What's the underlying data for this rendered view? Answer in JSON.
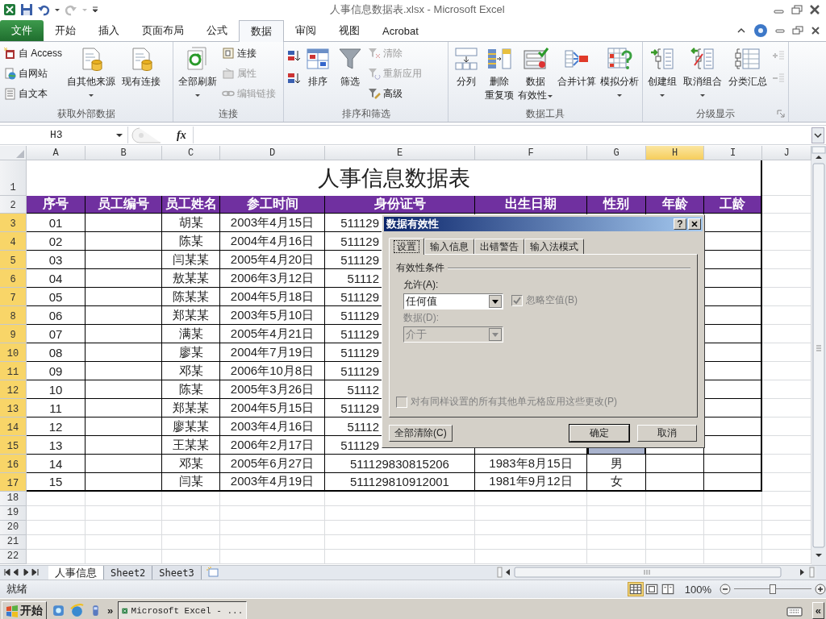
{
  "window": {
    "title": "人事信息数据表.xlsx - Microsoft Excel"
  },
  "ribbon_tabs": [
    {
      "label": "文件",
      "kind": "file",
      "selected": false
    },
    {
      "label": "开始",
      "kind": "tab",
      "selected": false
    },
    {
      "label": "插入",
      "kind": "tab",
      "selected": false
    },
    {
      "label": "页面布局",
      "kind": "tab",
      "selected": false
    },
    {
      "label": "公式",
      "kind": "tab",
      "selected": false
    },
    {
      "label": "数据",
      "kind": "tab",
      "selected": true
    },
    {
      "label": "审阅",
      "kind": "tab",
      "selected": false
    },
    {
      "label": "视图",
      "kind": "tab",
      "selected": false
    },
    {
      "label": "Acrobat",
      "kind": "tab",
      "selected": false
    }
  ],
  "ribbon_groups": [
    {
      "label": "获取外部数据",
      "columns": [
        {
          "kind": "stack",
          "items": [
            {
              "label": "自 Access",
              "disabled": false
            },
            {
              "label": "自网站",
              "disabled": false
            },
            {
              "label": "自文本",
              "disabled": false
            }
          ]
        },
        {
          "kind": "large",
          "lines": [
            "自其他来源"
          ],
          "dropdown": true,
          "disabled": false
        },
        {
          "kind": "large",
          "lines": [
            "现有连接"
          ],
          "disabled": false
        }
      ]
    },
    {
      "label": "连接",
      "columns": [
        {
          "kind": "large",
          "lines": [
            "全部刷新"
          ],
          "dropdown": true,
          "disabled": false
        },
        {
          "kind": "stack",
          "items": [
            {
              "label": "连接",
              "disabled": false
            },
            {
              "label": "属性",
              "disabled": true
            },
            {
              "label": "编辑链接",
              "disabled": true
            }
          ]
        }
      ]
    },
    {
      "label": "排序和筛选",
      "columns": [
        {
          "kind": "icons",
          "items": [
            {
              "disabled": false
            },
            {
              "disabled": false
            }
          ]
        },
        {
          "kind": "large",
          "lines": [
            "排序"
          ],
          "disabled": false
        },
        {
          "kind": "large",
          "lines": [
            "筛选"
          ],
          "disabled": false
        },
        {
          "kind": "stack",
          "items": [
            {
              "label": "清除",
              "disabled": true
            },
            {
              "label": "重新应用",
              "disabled": true
            },
            {
              "label": "高级",
              "disabled": false
            }
          ]
        }
      ]
    },
    {
      "label": "数据工具",
      "columns": [
        {
          "kind": "large",
          "lines": [
            "分列"
          ],
          "disabled": false
        },
        {
          "kind": "large",
          "lines": [
            "删除",
            "重复项"
          ],
          "disabled": false
        },
        {
          "kind": "large",
          "lines": [
            "数据",
            "有效性"
          ],
          "dropdown": true,
          "disabled": false
        },
        {
          "kind": "large",
          "lines": [
            "合并计算"
          ],
          "disabled": false
        },
        {
          "kind": "large",
          "lines": [
            "模拟分析"
          ],
          "dropdown": true,
          "disabled": false
        }
      ]
    },
    {
      "label": "分级显示",
      "launcher": true,
      "columns": [
        {
          "kind": "large",
          "lines": [
            "创建组"
          ],
          "dropdown": true,
          "disabled": false
        },
        {
          "kind": "large",
          "lines": [
            "取消组合"
          ],
          "dropdown": true,
          "disabled": false
        },
        {
          "kind": "large",
          "lines": [
            "分类汇总"
          ],
          "disabled": false
        },
        {
          "kind": "icons",
          "items": [
            {
              "disabled": true
            },
            {
              "disabled": true
            }
          ]
        }
      ]
    }
  ],
  "formula_bar": {
    "name_box": "H3",
    "function_label": "fx"
  },
  "sheet": {
    "columns": [
      {
        "label": "A",
        "selected": false
      },
      {
        "label": "B",
        "selected": false
      },
      {
        "label": "C",
        "selected": false
      },
      {
        "label": "D",
        "selected": false
      },
      {
        "label": "E",
        "selected": false
      },
      {
        "label": "F",
        "selected": false
      },
      {
        "label": "G",
        "selected": false
      },
      {
        "label": "H",
        "selected": true
      },
      {
        "label": "I",
        "selected": false
      },
      {
        "label": "J",
        "selected": false
      }
    ],
    "title_row": "1",
    "title": "人事信息数据表",
    "header_row": "2",
    "headers": [
      "序号",
      "员工编号",
      "员工姓名",
      "参工时间",
      "身份证号",
      "出生日期",
      "性别",
      "年龄",
      "工龄"
    ],
    "rows": [
      {
        "number": "3",
        "selected": true,
        "seq": "01",
        "name": "胡某",
        "join": "2003年4月15日",
        "id": "511129"
      },
      {
        "number": "4",
        "selected": true,
        "seq": "02",
        "name": "陈某",
        "join": "2004年4月16日",
        "id": "511129"
      },
      {
        "number": "5",
        "selected": true,
        "seq": "03",
        "name": "闫某某",
        "join": "2005年4月20日",
        "id": "511129"
      },
      {
        "number": "6",
        "selected": true,
        "seq": "04",
        "name": "敖某某",
        "join": "2006年3月12日",
        "id": "51112"
      },
      {
        "number": "7",
        "selected": true,
        "seq": "05",
        "name": "陈某某",
        "join": "2004年5月18日",
        "id": "511129"
      },
      {
        "number": "8",
        "selected": true,
        "seq": "06",
        "name": "郑某某",
        "join": "2003年5月10日",
        "id": "511129"
      },
      {
        "number": "9",
        "selected": true,
        "seq": "07",
        "name": "满某",
        "join": "2005年4月21日",
        "id": "511129"
      },
      {
        "number": "10",
        "selected": true,
        "seq": "08",
        "name": "廖某",
        "join": "2004年7月19日",
        "id": "511129"
      },
      {
        "number": "11",
        "selected": true,
        "seq": "09",
        "name": "邓某",
        "join": "2006年10月8日",
        "id": "511129"
      },
      {
        "number": "12",
        "selected": true,
        "seq": "10",
        "name": "陈某",
        "join": "2005年3月26日",
        "id": "51112"
      },
      {
        "number": "13",
        "selected": true,
        "seq": "11",
        "name": "郑某某",
        "join": "2004年5月15日",
        "id": "511129"
      },
      {
        "number": "14",
        "selected": true,
        "seq": "12",
        "name": "廖某某",
        "join": "2003年4月16日",
        "id": "51112"
      },
      {
        "number": "15",
        "selected": true,
        "seq": "13",
        "name": "王某某",
        "join": "2006年2月17日",
        "id": "511129"
      },
      {
        "number": "16",
        "selected": true,
        "seq": "14",
        "name": "邓某",
        "join": "2005年6月27日",
        "id": "511129830815206",
        "birth": "1983年8月15日",
        "gender": "男"
      },
      {
        "number": "17",
        "selected": true,
        "seq": "15",
        "name": "闫某",
        "join": "2003年4月19日",
        "id": "511129810912001",
        "birth": "1981年9月12日",
        "gender": "女"
      }
    ],
    "empty_rows": [
      "18",
      "19",
      "20",
      "21",
      "22"
    ]
  },
  "dialog": {
    "title": "数据有效性",
    "help": "?",
    "tabs": [
      {
        "label": "设置",
        "selected": true
      },
      {
        "label": "输入信息",
        "selected": false
      },
      {
        "label": "出错警告",
        "selected": false
      },
      {
        "label": "输入法模式",
        "selected": false
      }
    ],
    "section": "有效性条件",
    "allow": {
      "label": "允许(A):",
      "value": "任何值",
      "disabled": false
    },
    "ignore_blank": {
      "label": "忽略空值(B)",
      "checked": true,
      "disabled": true
    },
    "data": {
      "label": "数据(D):",
      "value": "介于",
      "disabled": true
    },
    "apply_all": {
      "label": "对有同样设置的所有其他单元格应用这些更改(P)",
      "checked": false,
      "disabled": true
    },
    "buttons": [
      {
        "label": "全部清除(C)",
        "default": false
      },
      {
        "label": "确定",
        "default": true
      },
      {
        "label": "取消",
        "default": false
      }
    ]
  },
  "sheet_tabs": [
    {
      "label": "人事信息",
      "selected": true
    },
    {
      "label": "Sheet2",
      "selected": false
    },
    {
      "label": "Sheet3",
      "selected": false
    }
  ],
  "status_bar": {
    "text": "就绪",
    "views": [
      {
        "selected": true
      },
      {
        "selected": false
      },
      {
        "selected": false
      }
    ],
    "zoom": "100%",
    "level": 0.5
  },
  "taskbar": {
    "start": "开始",
    "more": "»",
    "task": "Microsoft Excel - ...",
    "tray_more": "«"
  }
}
